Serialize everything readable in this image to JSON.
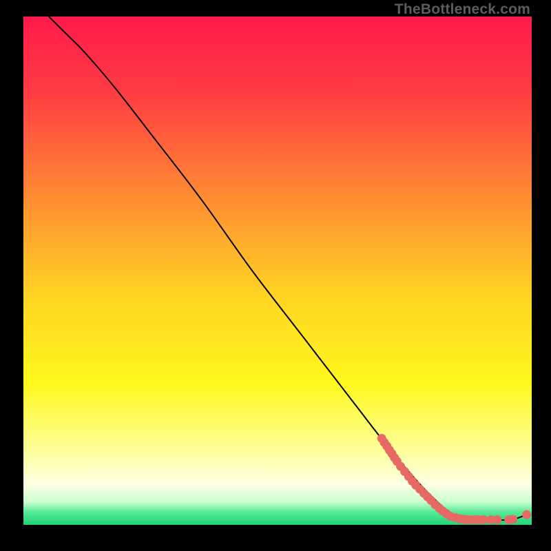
{
  "watermark": "TheBottleneck.com",
  "chart_data": {
    "type": "line",
    "title": "",
    "xlabel": "",
    "ylabel": "",
    "xlim": [
      0,
      100
    ],
    "ylim": [
      0,
      100
    ],
    "grid": false,
    "series": [
      {
        "name": "curve",
        "style": "black-line",
        "points": [
          {
            "x": 5,
            "y": 100
          },
          {
            "x": 8,
            "y": 97
          },
          {
            "x": 12,
            "y": 93
          },
          {
            "x": 18,
            "y": 86
          },
          {
            "x": 25,
            "y": 77
          },
          {
            "x": 35,
            "y": 64
          },
          {
            "x": 45,
            "y": 50
          },
          {
            "x": 55,
            "y": 37
          },
          {
            "x": 65,
            "y": 24
          },
          {
            "x": 72,
            "y": 15
          },
          {
            "x": 78,
            "y": 8
          },
          {
            "x": 82,
            "y": 4
          },
          {
            "x": 85,
            "y": 1.5
          },
          {
            "x": 88,
            "y": 1
          },
          {
            "x": 92,
            "y": 1
          },
          {
            "x": 96,
            "y": 1
          },
          {
            "x": 99,
            "y": 2
          }
        ]
      },
      {
        "name": "highlight-dots",
        "style": "salmon-dots",
        "points": [
          {
            "x": 70.5,
            "y": 17.0
          },
          {
            "x": 71.0,
            "y": 16.2
          },
          {
            "x": 71.5,
            "y": 15.5
          },
          {
            "x": 72.0,
            "y": 14.7
          },
          {
            "x": 72.5,
            "y": 14.0
          },
          {
            "x": 73.0,
            "y": 13.2
          },
          {
            "x": 73.5,
            "y": 12.5
          },
          {
            "x": 74.2,
            "y": 11.5
          },
          {
            "x": 75.0,
            "y": 10.5
          },
          {
            "x": 75.8,
            "y": 9.5
          },
          {
            "x": 76.5,
            "y": 8.6
          },
          {
            "x": 77.2,
            "y": 7.8
          },
          {
            "x": 78.0,
            "y": 7.0
          },
          {
            "x": 78.8,
            "y": 6.2
          },
          {
            "x": 79.5,
            "y": 5.5
          },
          {
            "x": 80.2,
            "y": 4.8
          },
          {
            "x": 81.0,
            "y": 4.0
          },
          {
            "x": 81.8,
            "y": 3.3
          },
          {
            "x": 82.5,
            "y": 2.7
          },
          {
            "x": 83.2,
            "y": 2.2
          },
          {
            "x": 84.0,
            "y": 1.7
          },
          {
            "x": 85.0,
            "y": 1.4
          },
          {
            "x": 85.8,
            "y": 1.2
          },
          {
            "x": 86.5,
            "y": 1.1
          },
          {
            "x": 87.2,
            "y": 1.0
          },
          {
            "x": 88.0,
            "y": 1.0
          },
          {
            "x": 88.8,
            "y": 1.0
          },
          {
            "x": 89.5,
            "y": 1.0
          },
          {
            "x": 90.5,
            "y": 1.0
          },
          {
            "x": 92.0,
            "y": 1.0
          },
          {
            "x": 93.2,
            "y": 1.0
          },
          {
            "x": 95.5,
            "y": 1.0
          },
          {
            "x": 96.3,
            "y": 1.1
          },
          {
            "x": 99.0,
            "y": 2.0
          }
        ]
      }
    ],
    "background_gradient": {
      "stops": [
        {
          "pos": 0.0,
          "color": "#ff1a4b"
        },
        {
          "pos": 0.15,
          "color": "#ff3c43"
        },
        {
          "pos": 0.35,
          "color": "#ff8a33"
        },
        {
          "pos": 0.55,
          "color": "#ffd423"
        },
        {
          "pos": 0.72,
          "color": "#fff81c"
        },
        {
          "pos": 0.86,
          "color": "#fdffa0"
        },
        {
          "pos": 0.92,
          "color": "#feffe4"
        },
        {
          "pos": 0.955,
          "color": "#c9ffd0"
        },
        {
          "pos": 0.975,
          "color": "#57e896"
        },
        {
          "pos": 1.0,
          "color": "#1fd678"
        }
      ]
    }
  }
}
